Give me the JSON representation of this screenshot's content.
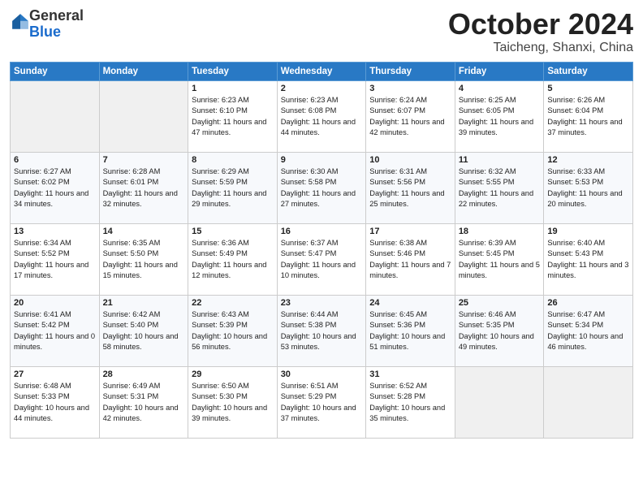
{
  "header": {
    "logo_general": "General",
    "logo_blue": "Blue",
    "month": "October 2024",
    "location": "Taicheng, Shanxi, China"
  },
  "weekdays": [
    "Sunday",
    "Monday",
    "Tuesday",
    "Wednesday",
    "Thursday",
    "Friday",
    "Saturday"
  ],
  "weeks": [
    [
      {
        "day": "",
        "info": ""
      },
      {
        "day": "",
        "info": ""
      },
      {
        "day": "1",
        "info": "Sunrise: 6:23 AM\nSunset: 6:10 PM\nDaylight: 11 hours and 47 minutes."
      },
      {
        "day": "2",
        "info": "Sunrise: 6:23 AM\nSunset: 6:08 PM\nDaylight: 11 hours and 44 minutes."
      },
      {
        "day": "3",
        "info": "Sunrise: 6:24 AM\nSunset: 6:07 PM\nDaylight: 11 hours and 42 minutes."
      },
      {
        "day": "4",
        "info": "Sunrise: 6:25 AM\nSunset: 6:05 PM\nDaylight: 11 hours and 39 minutes."
      },
      {
        "day": "5",
        "info": "Sunrise: 6:26 AM\nSunset: 6:04 PM\nDaylight: 11 hours and 37 minutes."
      }
    ],
    [
      {
        "day": "6",
        "info": "Sunrise: 6:27 AM\nSunset: 6:02 PM\nDaylight: 11 hours and 34 minutes."
      },
      {
        "day": "7",
        "info": "Sunrise: 6:28 AM\nSunset: 6:01 PM\nDaylight: 11 hours and 32 minutes."
      },
      {
        "day": "8",
        "info": "Sunrise: 6:29 AM\nSunset: 5:59 PM\nDaylight: 11 hours and 29 minutes."
      },
      {
        "day": "9",
        "info": "Sunrise: 6:30 AM\nSunset: 5:58 PM\nDaylight: 11 hours and 27 minutes."
      },
      {
        "day": "10",
        "info": "Sunrise: 6:31 AM\nSunset: 5:56 PM\nDaylight: 11 hours and 25 minutes."
      },
      {
        "day": "11",
        "info": "Sunrise: 6:32 AM\nSunset: 5:55 PM\nDaylight: 11 hours and 22 minutes."
      },
      {
        "day": "12",
        "info": "Sunrise: 6:33 AM\nSunset: 5:53 PM\nDaylight: 11 hours and 20 minutes."
      }
    ],
    [
      {
        "day": "13",
        "info": "Sunrise: 6:34 AM\nSunset: 5:52 PM\nDaylight: 11 hours and 17 minutes."
      },
      {
        "day": "14",
        "info": "Sunrise: 6:35 AM\nSunset: 5:50 PM\nDaylight: 11 hours and 15 minutes."
      },
      {
        "day": "15",
        "info": "Sunrise: 6:36 AM\nSunset: 5:49 PM\nDaylight: 11 hours and 12 minutes."
      },
      {
        "day": "16",
        "info": "Sunrise: 6:37 AM\nSunset: 5:47 PM\nDaylight: 11 hours and 10 minutes."
      },
      {
        "day": "17",
        "info": "Sunrise: 6:38 AM\nSunset: 5:46 PM\nDaylight: 11 hours and 7 minutes."
      },
      {
        "day": "18",
        "info": "Sunrise: 6:39 AM\nSunset: 5:45 PM\nDaylight: 11 hours and 5 minutes."
      },
      {
        "day": "19",
        "info": "Sunrise: 6:40 AM\nSunset: 5:43 PM\nDaylight: 11 hours and 3 minutes."
      }
    ],
    [
      {
        "day": "20",
        "info": "Sunrise: 6:41 AM\nSunset: 5:42 PM\nDaylight: 11 hours and 0 minutes."
      },
      {
        "day": "21",
        "info": "Sunrise: 6:42 AM\nSunset: 5:40 PM\nDaylight: 10 hours and 58 minutes."
      },
      {
        "day": "22",
        "info": "Sunrise: 6:43 AM\nSunset: 5:39 PM\nDaylight: 10 hours and 56 minutes."
      },
      {
        "day": "23",
        "info": "Sunrise: 6:44 AM\nSunset: 5:38 PM\nDaylight: 10 hours and 53 minutes."
      },
      {
        "day": "24",
        "info": "Sunrise: 6:45 AM\nSunset: 5:36 PM\nDaylight: 10 hours and 51 minutes."
      },
      {
        "day": "25",
        "info": "Sunrise: 6:46 AM\nSunset: 5:35 PM\nDaylight: 10 hours and 49 minutes."
      },
      {
        "day": "26",
        "info": "Sunrise: 6:47 AM\nSunset: 5:34 PM\nDaylight: 10 hours and 46 minutes."
      }
    ],
    [
      {
        "day": "27",
        "info": "Sunrise: 6:48 AM\nSunset: 5:33 PM\nDaylight: 10 hours and 44 minutes."
      },
      {
        "day": "28",
        "info": "Sunrise: 6:49 AM\nSunset: 5:31 PM\nDaylight: 10 hours and 42 minutes."
      },
      {
        "day": "29",
        "info": "Sunrise: 6:50 AM\nSunset: 5:30 PM\nDaylight: 10 hours and 39 minutes."
      },
      {
        "day": "30",
        "info": "Sunrise: 6:51 AM\nSunset: 5:29 PM\nDaylight: 10 hours and 37 minutes."
      },
      {
        "day": "31",
        "info": "Sunrise: 6:52 AM\nSunset: 5:28 PM\nDaylight: 10 hours and 35 minutes."
      },
      {
        "day": "",
        "info": ""
      },
      {
        "day": "",
        "info": ""
      }
    ]
  ]
}
